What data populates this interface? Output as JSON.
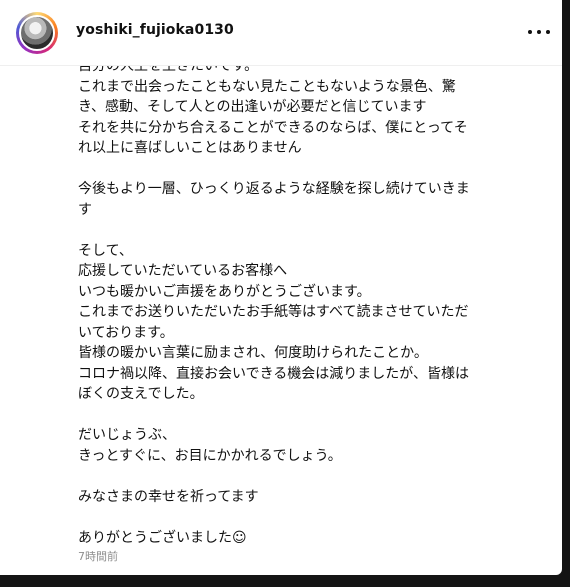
{
  "post": {
    "username": "yoshiki_fujioka0130",
    "more_icon": "more-horizontal-icon",
    "caption_lines": [
      "自分の人生を生きたいです。",
      "これまで出会ったこともない見たこともないような景色、驚",
      "き、感動、そして人との出逢いが必要だと信じています",
      "それを共に分かち合えることができるのならば、僕にとってそ",
      "れ以上に喜ばしいことはありません",
      "",
      "今後もより一層、ひっくり返るような経験を探し続けていきま",
      "す",
      "",
      "そして、",
      "応援していただいているお客様へ",
      "いつも暖かいご声援をありがとうございます。",
      "これまでお送りいただいたお手紙等はすべて読まさせていただ",
      "いております。",
      "皆様の暖かい言葉に励まされ、何度助けられたことか。",
      "コロナ禍以降、直接お会いできる機会は減りましたが、皆様は",
      "ぼくの支えでした。",
      "",
      "だいじょうぶ、",
      "きっとすぐに、お目にかかれるでしょう。",
      "",
      "みなさまの幸せを祈ってます",
      "",
      "ありがとうございました☺"
    ],
    "timestamp": "7時間前"
  }
}
